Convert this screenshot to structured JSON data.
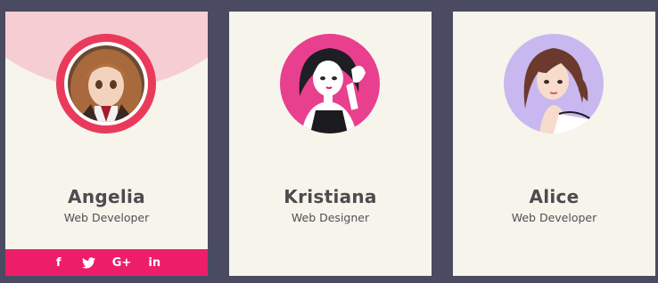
{
  "cards": [
    {
      "name": "Angelia",
      "role": "Web Developer",
      "avatar_bg": "#8a5a3a",
      "highlighted": true,
      "social": [
        {
          "icon": "facebook-icon",
          "glyph": "f"
        },
        {
          "icon": "twitter-icon",
          "glyph": ""
        },
        {
          "icon": "google-plus-icon",
          "glyph": "G+"
        },
        {
          "icon": "linkedin-icon",
          "glyph": "in"
        }
      ]
    },
    {
      "name": "Kristiana",
      "role": "Web Designer",
      "avatar_bg": "#e93f8f"
    },
    {
      "name": "Alice",
      "role": "Web Developer",
      "avatar_bg": "#c8b8ef"
    }
  ],
  "colors": {
    "page_bg": "#4a4a63",
    "card_bg": "#f7f4ec",
    "accent": "#ec1e6a",
    "ring": "#ea3a5c",
    "arc": "#f6cdd2"
  }
}
